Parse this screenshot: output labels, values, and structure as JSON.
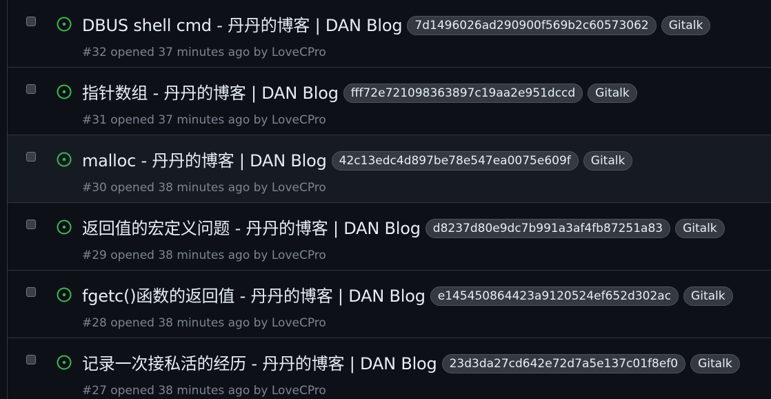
{
  "issues": [
    {
      "title": "DBUS shell cmd - 丹丹的博客 | DAN Blog",
      "labels": [
        "7d1496026ad290900f569b2c60573062",
        "Gitalk"
      ],
      "meta": "#32 opened 37 minutes ago by LoveCPro"
    },
    {
      "title": "指针数组 - 丹丹的博客 | DAN Blog",
      "labels": [
        "fff72e721098363897c19aa2e951dccd",
        "Gitalk"
      ],
      "meta": "#31 opened 37 minutes ago by LoveCPro"
    },
    {
      "title": "malloc - 丹丹的博客 | DAN Blog",
      "labels": [
        "42c13edc4d897be78e547ea0075e609f",
        "Gitalk"
      ],
      "meta": "#30 opened 38 minutes ago by LoveCPro"
    },
    {
      "title": "返回值的宏定义问题 - 丹丹的博客 | DAN Blog",
      "labels": [
        "d8237d80e9dc7b991a3af4fb87251a83",
        "Gitalk"
      ],
      "meta": "#29 opened 38 minutes ago by LoveCPro"
    },
    {
      "title": "fgetc()函数的返回值 - 丹丹的博客 | DAN Blog",
      "labels": [
        "e145450864423a9120524ef652d302ac",
        "Gitalk"
      ],
      "meta": "#28 opened 38 minutes ago by LoveCPro"
    },
    {
      "title": "记录一次接私活的经历 - 丹丹的博客 | DAN Blog",
      "labels": [
        "23d3da27cd642e72d7a5e137c01f8ef0",
        "Gitalk"
      ],
      "meta": "#27 opened 38 minutes ago by LoveCPro"
    }
  ],
  "colors": {
    "open_status": "#3fb950",
    "background": "#0d1117",
    "hover_row": "#161b22",
    "label_bg": "#353a41"
  },
  "icons": {
    "status": "issue-opened-icon"
  }
}
